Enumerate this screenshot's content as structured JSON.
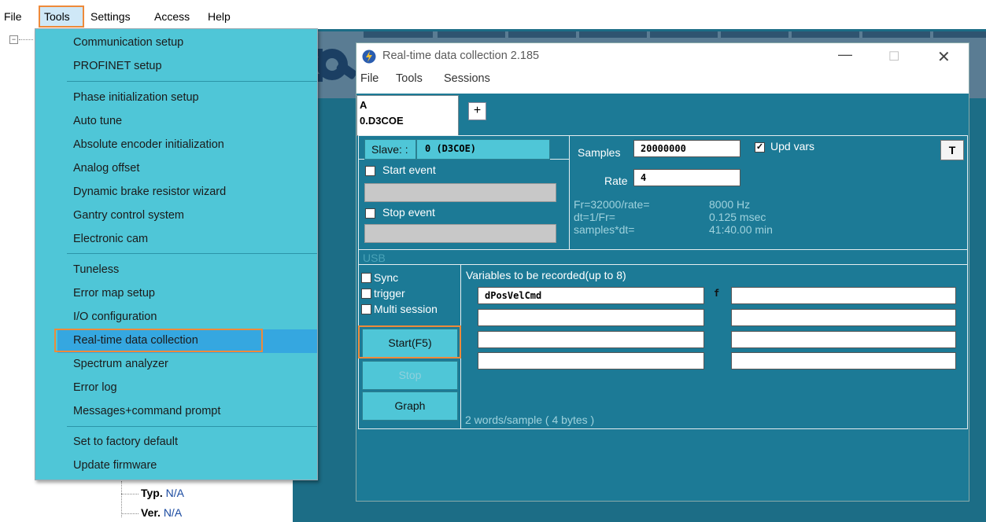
{
  "menubar": {
    "file": "File",
    "tools": "Tools",
    "settings": "Settings",
    "access": "Access",
    "help": "Help"
  },
  "tools_menu": {
    "group1": [
      "Communication setup",
      "PROFINET setup"
    ],
    "group2": [
      "Phase initialization setup",
      "Auto tune",
      "Absolute encoder initialization",
      "Analog offset",
      "Dynamic brake resistor wizard",
      "Gantry control system",
      "Electronic cam"
    ],
    "group3": [
      "Tuneless",
      "Error map setup",
      "I/O configuration",
      "Real-time data collection",
      "Spectrum analyzer",
      "Error log",
      "Messages+command prompt"
    ],
    "group4": [
      "Set to factory default",
      "Update firmware"
    ],
    "highlighted": "Real-time data collection"
  },
  "tree": {
    "collapse_glyph": "−",
    "rows": [
      {
        "key": "Typ.",
        "value": "N/A"
      },
      {
        "key": "Ver.",
        "value": "N/A"
      }
    ]
  },
  "dialog": {
    "title": "Real-time data collection 2.185",
    "menu": [
      "File",
      "Tools",
      "Sessions"
    ],
    "tab": {
      "letter": "A",
      "name": "0.D3COE",
      "add_label": "+"
    },
    "slave_label": "Slave: :",
    "slave_value": "0 (D3COE)",
    "samples_label": "Samples",
    "samples_value": "20000000",
    "upd_vars_label": "Upd vars",
    "upd_vars_checked": true,
    "rate_label": "Rate",
    "rate_value": "4",
    "t_button": "T",
    "start_event_label": "Start event",
    "stop_event_label": "Stop event",
    "fr_label": "Fr=32000/rate=",
    "fr_value": "8000 Hz",
    "dt_label": "dt=1/Fr=",
    "dt_value": "0.125 msec",
    "samples_dt_label": "samples*dt=",
    "samples_dt_value": "41:40.00 min",
    "usb_label": "USB",
    "sync_label": "Sync",
    "trigger_label": "trigger",
    "multi_session_label": "Multi session",
    "start_button": "Start(F5)",
    "stop_button": "Stop",
    "graph_button": "Graph",
    "variables_header": "Variables to be recorded(up to 8)",
    "variables_left": [
      "dPosVelCmd",
      "",
      "",
      ""
    ],
    "variables_left_type": [
      "f",
      "",
      "",
      ""
    ],
    "variables_right": [
      "",
      "",
      "",
      ""
    ],
    "words_per_sample": "2 words/sample ( 4 bytes )"
  },
  "colors": {
    "menu_bg": "#4fc6d7",
    "menu_highlight": "#35a7e0",
    "annotation_orange": "#ee8a3a",
    "dialog_bg": "#1c7a96"
  }
}
